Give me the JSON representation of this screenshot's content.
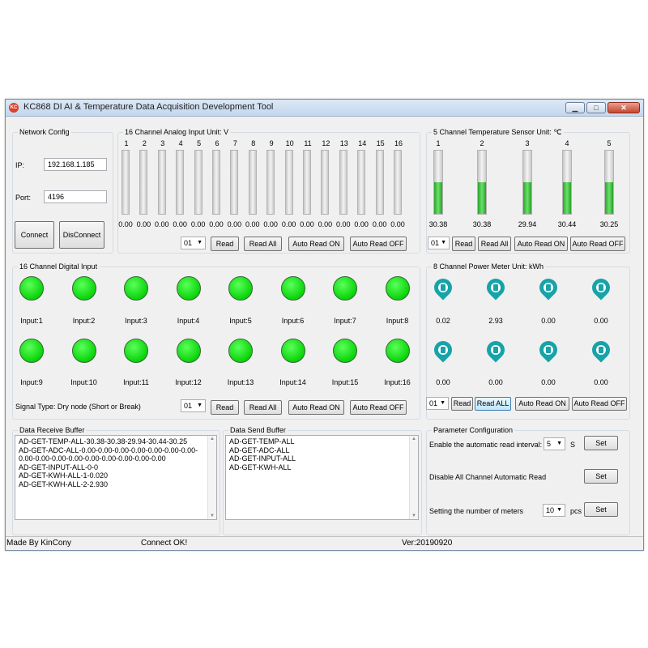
{
  "window": {
    "title": "KC868 DI AI & Temperature Data Acquisition Development Tool",
    "icon_label": "KC",
    "minimize_label": "▁",
    "maximize_label": "□",
    "close_label": "✕"
  },
  "network": {
    "group_label": "Network Config",
    "ip_label": "IP:",
    "ip_value": "192.168.1.185",
    "port_label": "Port:",
    "port_value": "4196",
    "connect_label": "Connect",
    "disconnect_label": "DisConnect"
  },
  "analog": {
    "group_label": "16 Channel Analog Input Unit: V",
    "channels": [
      "1",
      "2",
      "3",
      "4",
      "5",
      "6",
      "7",
      "8",
      "9",
      "10",
      "11",
      "12",
      "13",
      "14",
      "15",
      "16"
    ],
    "values": [
      "0.00",
      "0.00",
      "0.00",
      "0.00",
      "0.00",
      "0.00",
      "0.00",
      "0.00",
      "0.00",
      "0.00",
      "0.00",
      "0.00",
      "0.00",
      "0.00",
      "0.00",
      "0.00"
    ],
    "levels": [
      0,
      0,
      0,
      0,
      0,
      0,
      0,
      0,
      0,
      0,
      0,
      0,
      0,
      0,
      0,
      0
    ],
    "select_value": "01",
    "read_label": "Read",
    "read_all_label": "Read All",
    "auto_on_label": "Auto Read ON",
    "auto_off_label": "Auto Read OFF"
  },
  "temperature": {
    "group_label": "5 Channel Temperature Sensor Unit: ℃",
    "channels": [
      "1",
      "2",
      "3",
      "4",
      "5"
    ],
    "values": [
      "30.38",
      "30.38",
      "29.94",
      "30.44",
      "30.25"
    ],
    "levels": [
      0.5,
      0.5,
      0.5,
      0.5,
      0.5
    ],
    "select_value": "01",
    "read_label": "Read",
    "read_all_label": "Read All",
    "auto_on_label": "Auto Read ON",
    "auto_off_label": "Auto Read OFF"
  },
  "digital": {
    "group_label": "16 Channel Digital Input",
    "inputs": [
      "Input:1",
      "Input:2",
      "Input:3",
      "Input:4",
      "Input:5",
      "Input:6",
      "Input:7",
      "Input:8",
      "Input:9",
      "Input:10",
      "Input:11",
      "Input:12",
      "Input:13",
      "Input:14",
      "Input:15",
      "Input:16"
    ],
    "led_color": "#0ad40a",
    "signal_type": "Signal Type: Dry node (Short or Break)",
    "select_value": "01",
    "read_label": "Read",
    "read_all_label": "Read All",
    "auto_on_label": "Auto Read ON",
    "auto_off_label": "Auto Read OFF"
  },
  "power": {
    "group_label": "8 Channel Power Meter Unit: kWh",
    "values": [
      "0.02",
      "2.93",
      "0.00",
      "0.00",
      "0.00",
      "0.00",
      "0.00",
      "0.00"
    ],
    "icon_color": "#17a3a8",
    "select_value": "01",
    "read_label": "Read",
    "read_all_label": "Read ALL",
    "auto_on_label": "Auto Read ON",
    "auto_off_label": "Auto Read OFF"
  },
  "receive": {
    "group_label": "Data Receive Buffer",
    "lines": [
      "AD-GET-TEMP-ALL-30.38-30.38-29.94-30.44-30.25",
      "AD-GET-ADC-ALL-0.00-0.00-0.00-0.00-0.00-0.00-0.00-",
      "0.00-0.00-0.00-0.00-0.00-0.00-0.00-0.00-0.00",
      "AD-GET-INPUT-ALL-0-0",
      "AD-GET-KWH-ALL-1-0.020",
      "AD-GET-KWH-ALL-2-2.930"
    ]
  },
  "send": {
    "group_label": "Data Send Buffer",
    "lines": [
      "AD-GET-TEMP-ALL",
      "AD-GET-ADC-ALL",
      "AD-GET-INPUT-ALL",
      "AD-GET-KWH-ALL"
    ]
  },
  "params": {
    "group_label": "Parameter Configuration",
    "interval_label": "Enable the automatic read interval:",
    "interval_value": "5",
    "interval_unit": "S",
    "disable_label": "Disable All Channel Automatic Read",
    "meters_label": "Setting the number of meters",
    "meters_value": "10",
    "meters_unit": "pcs",
    "set_label": "Set"
  },
  "status": {
    "made_by": "Made By KinCony",
    "connection": "Connect OK!",
    "version": "Ver:20190920"
  },
  "dropdown_arrow": "▼",
  "scroll_up": "▲",
  "scroll_down": "▼"
}
